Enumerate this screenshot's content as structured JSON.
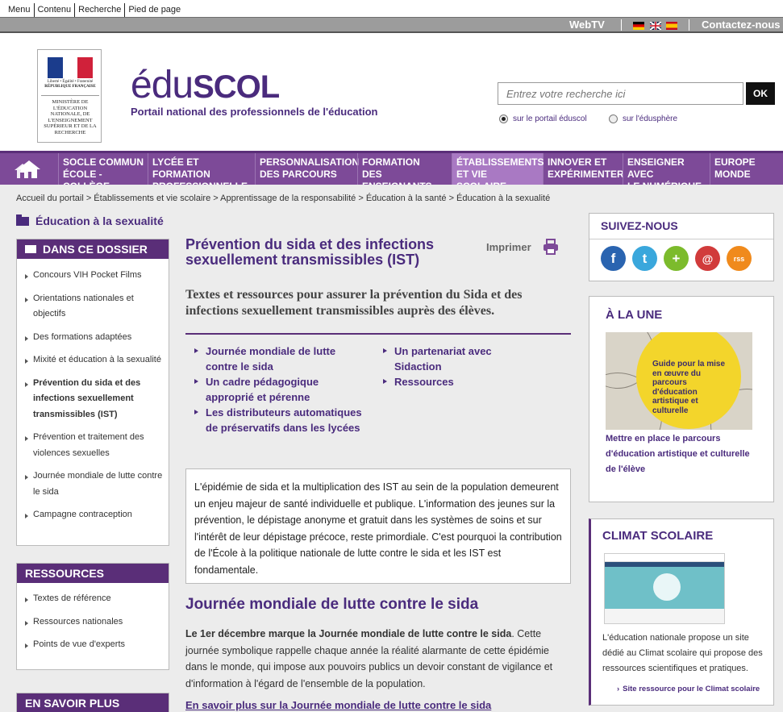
{
  "skip_links": [
    "Menu",
    "Contenu",
    "Recherche",
    "Pied de page"
  ],
  "utility": {
    "webtv": "WebTV",
    "contact": "Contactez-nous",
    "languages": [
      "de-flag",
      "uk-flag",
      "es-flag"
    ]
  },
  "header": {
    "ministry_logo_top": "Liberté • Égalité • Fraternité",
    "ministry_logo_rf": "RÉPUBLIQUE FRANÇAISE",
    "ministry_logo_text": "MINISTÈRE DE L'ÉDUCATION NATIONALE, DE L'ENSEIGNEMENT SUPÉRIEUR ET DE LA RECHERCHE",
    "brand_edu": "édu",
    "brand_scol": "SCOL",
    "tagline": "Portail national des professionnels de l'éducation",
    "search_placeholder": "Entrez votre recherche ici",
    "search_button": "OK",
    "radio_portal": "sur le portail éduscol",
    "radio_sphere": "sur l'édusphère"
  },
  "nav": {
    "tabs": [
      [
        "SOCLE COMMUN",
        "ÉCOLE - COLLÈGE"
      ],
      [
        "LYCÉE ET FORMATION",
        "PROFESSIONNELLE"
      ],
      [
        "PERSONNALISATION",
        "DES PARCOURS"
      ],
      [
        "FORMATION",
        "DES ENSEIGNANTS"
      ],
      [
        "ÉTABLISSEMENTS",
        "ET VIE SCOLAIRE"
      ],
      [
        "INNOVER ET",
        "EXPÉRIMENTER"
      ],
      [
        "ENSEIGNER AVEC",
        "LE NUMÉRIQUE"
      ],
      [
        "EUROPE",
        "MONDE"
      ]
    ]
  },
  "breadcrumb": "Accueil du portail > Établissements et vie scolaire > Apprentissage de la responsabilité > Éducation à la santé > Éducation à la sexualité",
  "section_title": "Éducation à la sexualité",
  "sidebar": {
    "dossier_title": "DANS CE DOSSIER",
    "dossier_items": [
      "Concours VIH Pocket Films",
      "Orientations nationales et objectifs",
      "Des formations adaptées",
      "Mixité et éducation à la sexualité",
      "Prévention du sida et des infections sexuellement transmissibles (IST)",
      "Prévention et traitement des violences sexuelles",
      "Journée mondiale de lutte contre le sida",
      "Campagne contraception"
    ],
    "resources_title": "RESSOURCES",
    "resources_items": [
      "Textes de référence",
      "Ressources nationales",
      "Points de vue d'experts"
    ],
    "more_title": "EN SAVOIR PLUS"
  },
  "article": {
    "title": "Prévention du sida et des infections sexuellement transmissibles (IST)",
    "print_label": "Imprimer",
    "lead": "Textes et ressources pour assurer la prévention du Sida et des infections sexuellement transmissibles auprès des élèves.",
    "toc_left": [
      "Journée mondiale de lutte contre le sida",
      "Un cadre pédagogique approprié et pérenne",
      "Les distributeurs automatiques de préservatifs dans les lycées"
    ],
    "toc_right": [
      "Un partenariat avec Sidaction",
      "Ressources"
    ],
    "intro": "L'épidémie de sida et la multiplication des IST au sein de la population demeurent un enjeu majeur de santé individuelle et publique. L'information des jeunes sur la prévention, le dépistage anonyme et gratuit dans les systèmes de soins et sur l'intérêt de leur dépistage précoce, reste primordiale. C'est pourquoi la contribution de l'École à la politique nationale de lutte contre le sida et les IST est fondamentale.",
    "h2": "Journée mondiale de lutte contre le sida",
    "body_bold": "Le 1er décembre marque la Journée mondiale de lutte contre le sida",
    "body_rest": ". Cette journée symbolique rappelle chaque année la réalité alarmante de cette épidémie dans le monde, qui impose aux pouvoirs publics un devoir constant de vigilance et d'information à l'égard de l'ensemble de la population.",
    "more_link": "En savoir plus sur la Journée mondiale de lutte contre le sida"
  },
  "right": {
    "follow_title": "SUIVEZ-NOUS",
    "social": [
      "f",
      "t",
      "+",
      "@",
      "rss"
    ],
    "une_title": "À LA UNE",
    "une_image_caption": "Guide pour la mise en œuvre du parcours d'éducation artistique et culturelle",
    "une_link": "Mettre en place le parcours d'éducation artistique et culturelle de l'élève",
    "climat_title": "CLIMAT SCOLAIRE",
    "climat_text": "L'éducation nationale propose un site dédié au Climat scolaire qui propose des ressources scientifiques et pratiques.",
    "climat_link": "Site ressource pour le Climat scolaire"
  },
  "colors": {
    "brand_purple": "#4a2b7d",
    "nav_purple": "#7d4a98",
    "active_tab": "#a979c3"
  }
}
